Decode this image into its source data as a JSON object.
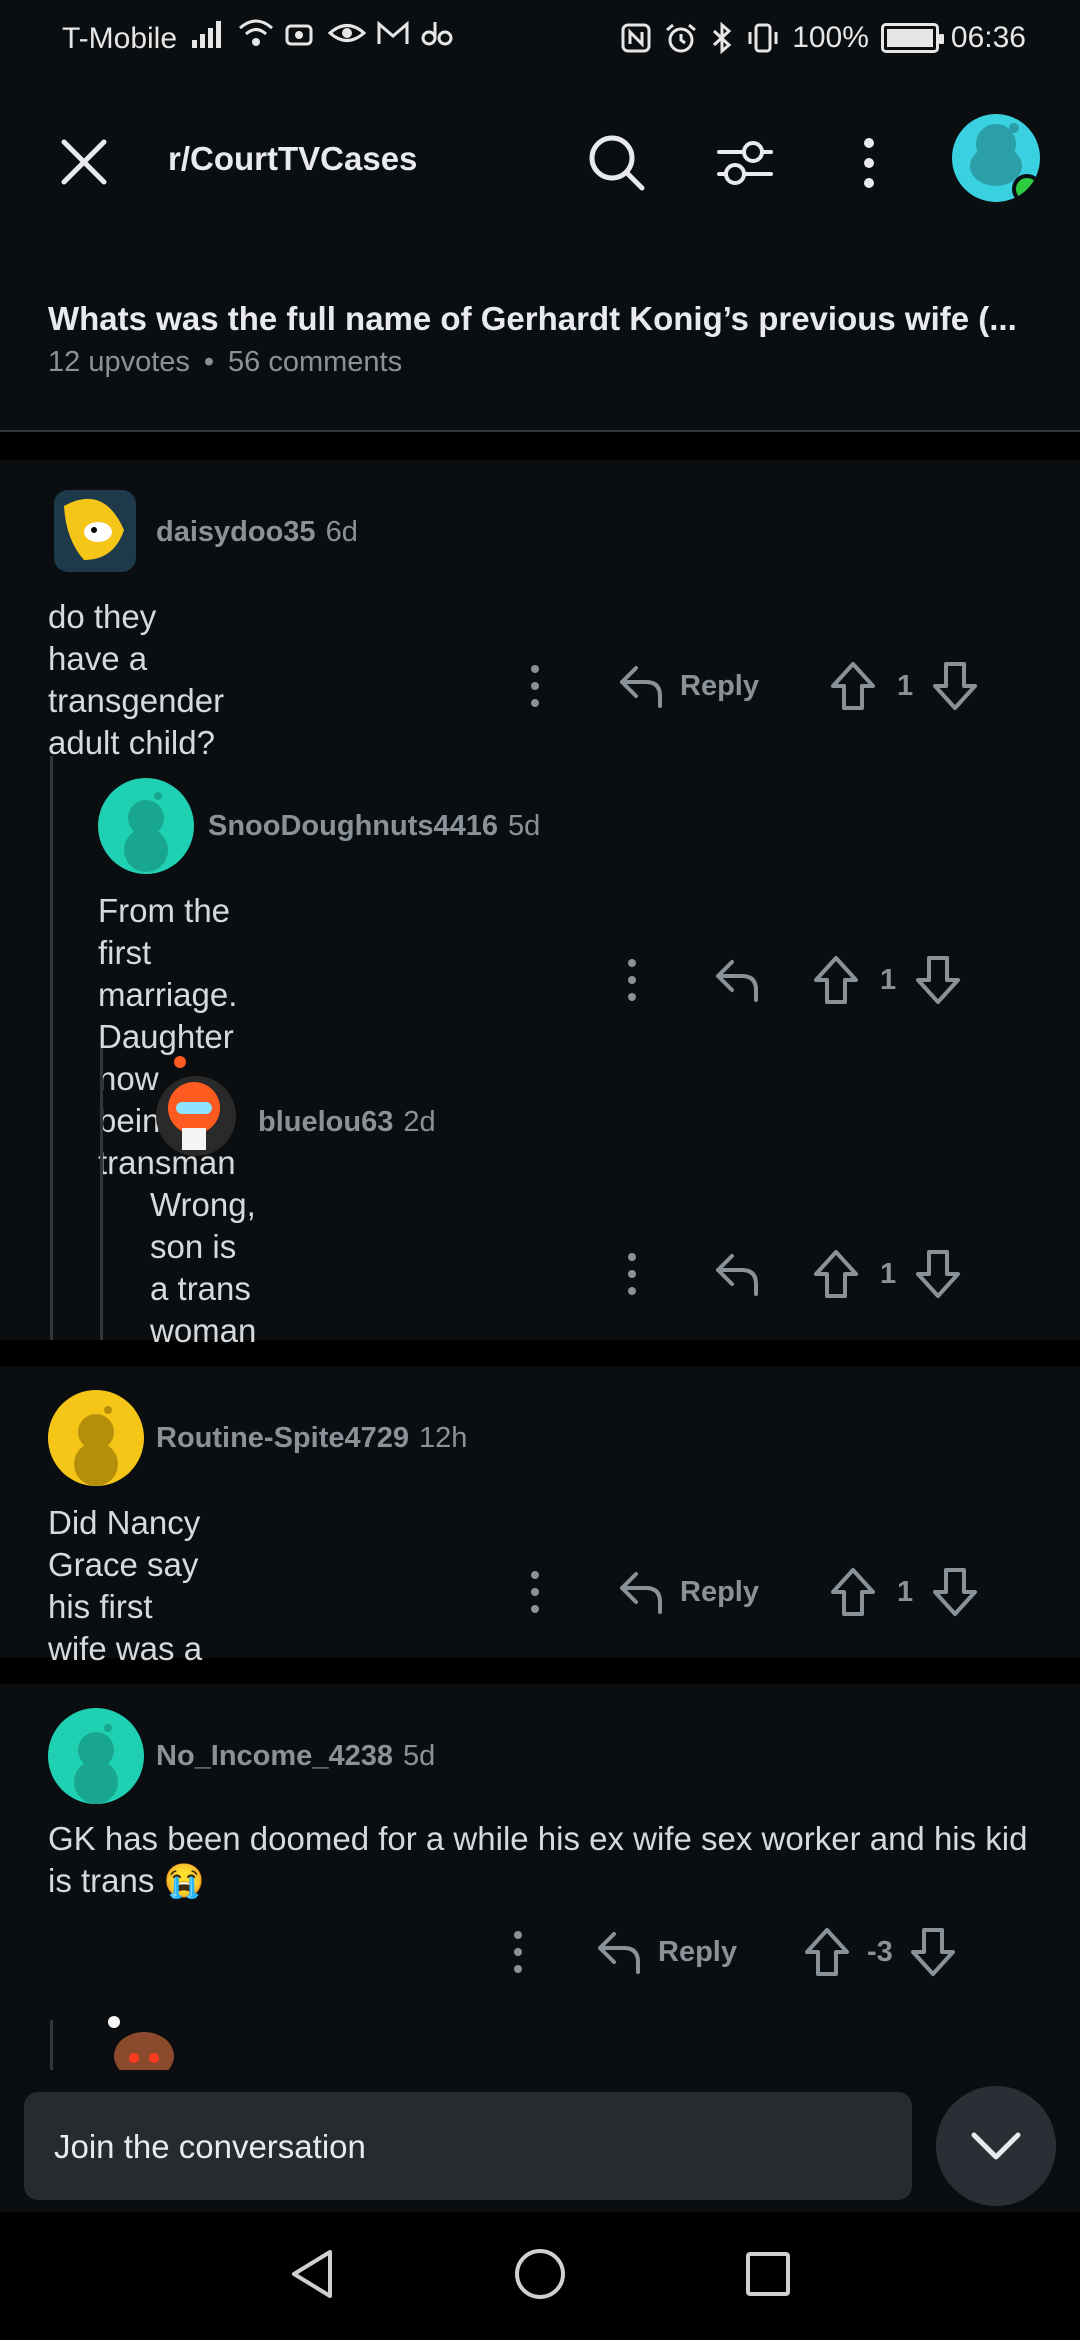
{
  "status_bar": {
    "carrier": "T-Mobile",
    "battery": "100%",
    "time": "06:36"
  },
  "header": {
    "subreddit": "r/CourtTVCases"
  },
  "post": {
    "title": "Whats was the full name of Gerhardt Konig’s previous wife (...",
    "upvotes": "12 upvotes",
    "comments": "56 comments"
  },
  "comments": [
    {
      "author": "daisydoo35",
      "age": "6d",
      "text": "do they have a transgender adult child?",
      "reply_label": "Reply",
      "score": "1",
      "avatar_color": "#1e3a4a"
    },
    {
      "author": "SnooDoughnuts4416",
      "age": "5d",
      "text": "From the first marriage. Daughter now being transman",
      "score": "1",
      "avatar_color": "#1fd1b2"
    },
    {
      "author": "bluelou63",
      "age": "2d",
      "text": "Wrong, son is a trans woman",
      "score": "1",
      "avatar_color": "#0b0e11"
    },
    {
      "author": "Routine-Spite4729",
      "age": "12h",
      "text": "Did Nancy Grace say his first wife was a sex worker???",
      "reply_label": "Reply",
      "score": "1",
      "avatar_color": "#f5c518"
    },
    {
      "author": "No_Income_4238",
      "age": "5d",
      "text": "GK has been doomed for a while his ex wife sex worker and his kid is trans 😭",
      "reply_label": "Reply",
      "score": "-3",
      "avatar_color": "#1fd1b2"
    }
  ],
  "composer": {
    "placeholder": "Join the conversation"
  }
}
